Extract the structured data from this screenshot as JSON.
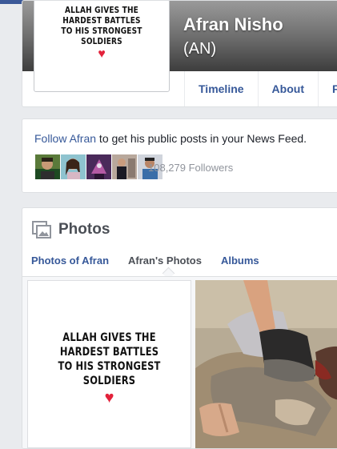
{
  "profile": {
    "name": "Afran Nisho",
    "nickname": "(AN)",
    "picture_caption": [
      "ALLAH GIVES THE",
      "HARDEST BATTLES",
      "TO HIS STRONGEST",
      "SOLDIERS"
    ],
    "heart": "♥"
  },
  "tabs": [
    "Timeline",
    "About",
    "F"
  ],
  "follow": {
    "link_text": "Follow Afran",
    "rest_text": " to get his public posts in your News Feed.",
    "followers": "108,279 Followers"
  },
  "photos": {
    "title": "Photos",
    "subtabs": [
      "Photos of Afran",
      "Afran's Photos",
      "Albums"
    ],
    "active_subtab": "Afran's Photos",
    "caption": [
      "ALLAH GIVES THE",
      "HARDEST BATTLES",
      "TO HIS STRONGEST",
      "SOLDIERS"
    ],
    "heart": "♥"
  },
  "colors": {
    "link": "#365899",
    "brand": "#3b5998",
    "heart": "#e3223b",
    "muted": "#90949c"
  }
}
